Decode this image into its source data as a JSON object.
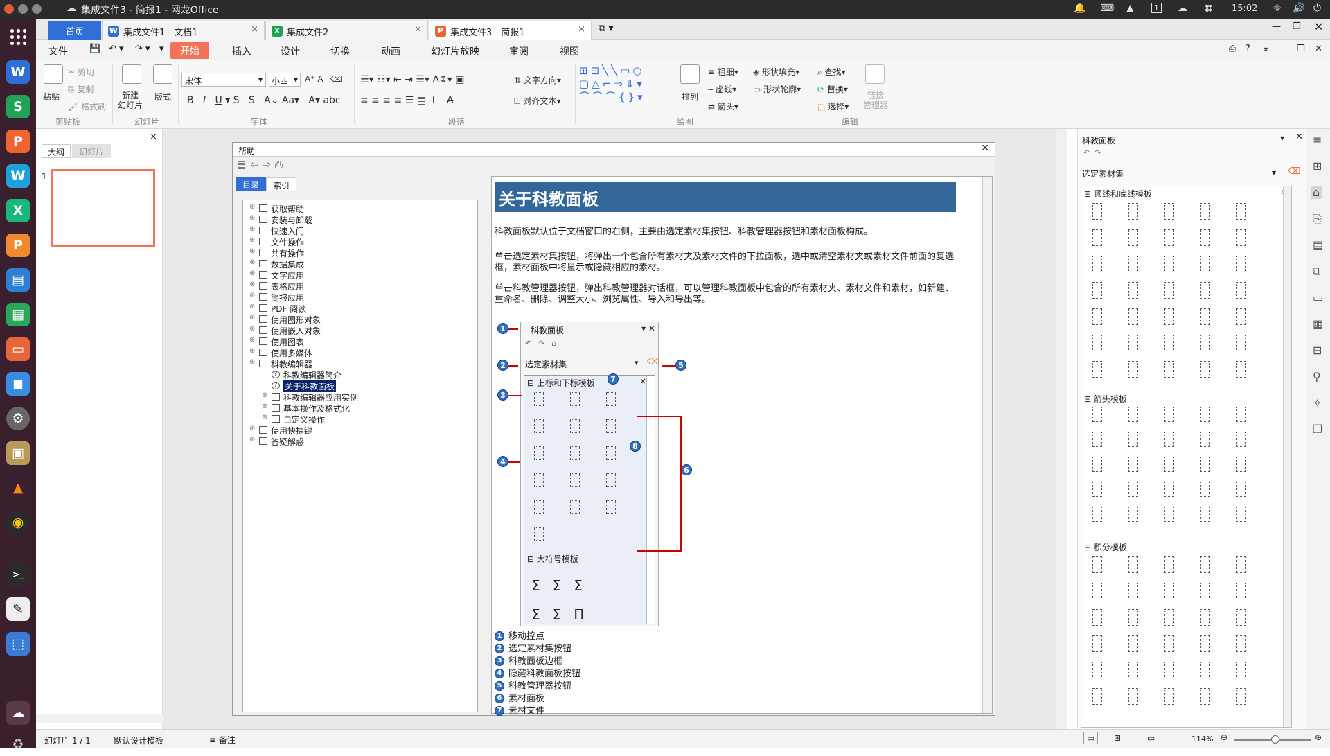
{
  "topbar": {
    "title": "集成文件3 - 简报1 - 网龙Office",
    "time": "15:02"
  },
  "tabs": [
    {
      "label": "首页"
    },
    {
      "label": "集成文件1 - 文档1",
      "icon": "W"
    },
    {
      "label": "集成文件2",
      "icon": "X"
    },
    {
      "label": "集成文件3 - 简报1",
      "icon": "P"
    }
  ],
  "menu": [
    "文件",
    "开始",
    "插入",
    "设计",
    "切换",
    "动画",
    "幻灯片放映",
    "审阅",
    "视图"
  ],
  "ribbon": {
    "clipboard": {
      "paste": "粘贴",
      "cut": "剪切",
      "copy": "复制",
      "format_brush": "格式刷",
      "group": "剪贴板"
    },
    "slides": {
      "new_slide": "新建\n幻灯片",
      "layout": "版式",
      "group": "幻灯片"
    },
    "font": {
      "name": "宋体",
      "size": "小四",
      "group": "字体"
    },
    "paragraph": {
      "text_direction": "文字方向",
      "align_text": "对齐文本",
      "group": "段落"
    },
    "drawing": {
      "arrange": "排列",
      "thickness": "粗细",
      "dash": "虚线",
      "arrow": "箭头",
      "shape_fill": "形状填充",
      "shape_outline": "形状轮廓",
      "group": "绘图"
    },
    "editing": {
      "find": "查找",
      "replace": "替换",
      "select": "选择",
      "group": "编辑"
    },
    "link_manager": "链接\n管理器"
  },
  "leftpane": {
    "tab_outline": "大纲",
    "tab_slides": "幻灯片",
    "slide_number": "1"
  },
  "help": {
    "title": "帮助",
    "tab_contents": "目录",
    "tab_index": "索引",
    "tree": [
      "获取帮助",
      "安装与卸载",
      "快速入门",
      "文件操作",
      "共有操作",
      "数据集成",
      "文字应用",
      "表格应用",
      "简报应用",
      "PDF 阅读",
      "使用图形对象",
      "使用嵌入对象",
      "使用图表",
      "使用多媒体",
      "科教编辑器",
      "科教编辑器简介",
      "关于科教面板",
      "科教编辑器应用实例",
      "基本操作及格式化",
      "自定义操作",
      "使用快捷键",
      "答疑解惑"
    ],
    "heading": "关于科教面板",
    "p1": "科教面板默认位于文档窗口的右侧，主要由选定素材集按钮、科教管理器按钮和素材面板构成。",
    "p2": "单击选定素材集按钮，将弹出一个包含所有素材夹及素材文件的下拉面板，选中或清空素材夹或素材文件前面的复选框，素材面板中将显示或隐藏相应的素材。",
    "p3": "单击科教管理器按钮，弹出科教管理器对话框，可以管理科教面板中包含的所有素材夹、素材文件和素材，如新建、重命名、删除、调整大小、浏览属性、导入和导出等。",
    "fig": {
      "panel_title": "科教面板",
      "select_set": "选定素材集",
      "sec1": "上标和下标模板",
      "sec2": "大符号模板"
    },
    "legend": [
      "移动控点",
      "选定素材集按钮",
      "科教面板边框",
      "隐藏科教面板按钮",
      "科教管理器按钮",
      "素材面板",
      "素材文件"
    ]
  },
  "rightpane": {
    "title": "科教面板",
    "select_set": "选定素材集",
    "sec1": "顶线和底线模板",
    "sec2": "箭头模板",
    "sec3": "积分模板"
  },
  "status": {
    "slide": "幻灯片 1 / 1",
    "template": "默认设计模板",
    "notes": "备注",
    "zoom": "114%"
  },
  "colors": {
    "accent": "#f0735a",
    "header_blue": "#336699",
    "tab_blue": "#2f6fd6"
  }
}
